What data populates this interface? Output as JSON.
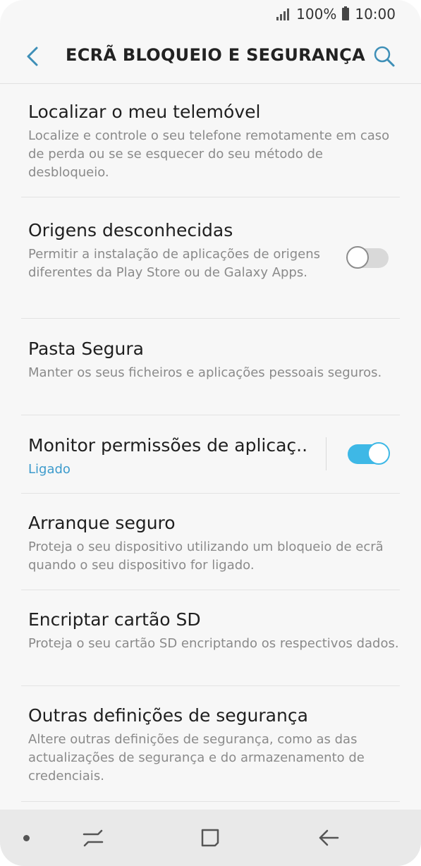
{
  "status_bar": {
    "battery_text": "100%",
    "time": "10:00"
  },
  "header": {
    "title": "ECRÃ BLOQUEIO E SEGURANÇA",
    "back_icon": "arrow-left-icon",
    "search_icon": "search-icon"
  },
  "settings": [
    {
      "title": "Localizar o meu telemóvel",
      "summary": "Localize e controle o seu telefone remotamente em caso de perda ou se se esquecer do seu método de desbloqueio."
    },
    {
      "title": "Origens desconhecidas",
      "summary": "Permitir a instalação de aplicações de origens diferentes da Play Store ou de Galaxy Apps.",
      "toggle": "off"
    },
    {
      "title": "Pasta Segura",
      "summary": "Manter os seus ficheiros e aplicações pessoais seguros."
    },
    {
      "title": "Monitor permissões de aplicaç..",
      "summary": "Ligado",
      "toggle": "on"
    },
    {
      "title": "Arranque seguro",
      "summary": "Proteja o seu dispositivo utilizando um bloqueio de ecrã quando o seu dispositivo for ligado."
    },
    {
      "title": "Encriptar cartão SD",
      "summary": "Proteja o seu cartão SD encriptando os respectivos dados."
    },
    {
      "title": "Outras definições de segurança",
      "summary": "Altere outras definições de segurança, como as das actualizações de segurança e do armazenamento de credenciais."
    }
  ],
  "colors": {
    "accent": "#3eb8e6",
    "summary_link": "#3d9bcc",
    "background": "#f7f7f7",
    "nav_bar": "#e9e9e9"
  },
  "nav_bar": {
    "recents_icon": "recent-apps-icon",
    "home_icon": "home-icon",
    "back_icon": "back-arrow-icon"
  }
}
